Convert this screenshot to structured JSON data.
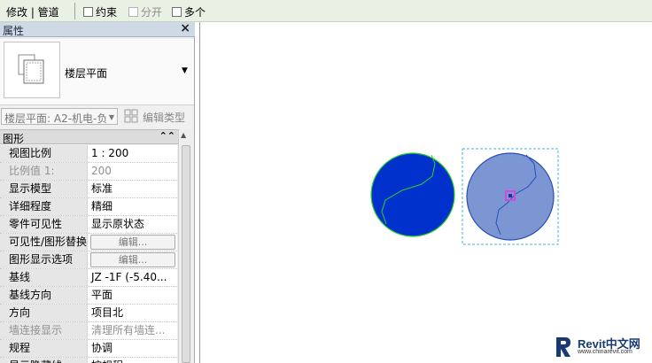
{
  "toolbar": {
    "context_title": "修改 | 管道",
    "options": [
      {
        "label": "约束",
        "checked": false,
        "enabled": true
      },
      {
        "label": "分开",
        "checked": false,
        "enabled": false
      },
      {
        "label": "多个",
        "checked": false,
        "enabled": true
      }
    ]
  },
  "properties": {
    "title": "属性",
    "close_icon": "×",
    "type_selector": {
      "type_name": "楼层平面",
      "thumbnail_icon": "floor-plan-view-icon",
      "dropdown_icon": "▼"
    },
    "instance_combo": {
      "value": "楼层平面: A2-机电-负",
      "dropdown_icon": "▼"
    },
    "edit_type_label": "编辑类型",
    "group": {
      "title": "图形",
      "collapse_icon": "⌃⌃"
    },
    "rows": [
      {
        "name": "视图比例",
        "value": "1 : 200",
        "enabled": true,
        "button": false
      },
      {
        "name": "比例值 1:",
        "value": "200",
        "enabled": false,
        "button": false
      },
      {
        "name": "显示模型",
        "value": "标准",
        "enabled": true,
        "button": false
      },
      {
        "name": "详细程度",
        "value": "精细",
        "enabled": true,
        "button": false
      },
      {
        "name": "零件可见性",
        "value": "显示原状态",
        "enabled": true,
        "button": false
      },
      {
        "name": "可见性/图形替换",
        "value": "编辑...",
        "enabled": true,
        "button": true
      },
      {
        "name": "图形显示选项",
        "value": "编辑...",
        "enabled": true,
        "button": true
      },
      {
        "name": "基线",
        "value": "JZ -1F (-5.40...",
        "enabled": true,
        "button": false
      },
      {
        "name": "基线方向",
        "value": "平面",
        "enabled": true,
        "button": false
      },
      {
        "name": "方向",
        "value": "项目北",
        "enabled": true,
        "button": false
      },
      {
        "name": "墙连接显示",
        "value": "清理所有墙连...",
        "enabled": false,
        "button": false
      },
      {
        "name": "规程",
        "value": "协调",
        "enabled": true,
        "button": false
      },
      {
        "name": "显示隐藏线",
        "value": "按规程",
        "enabled": true,
        "button": false
      }
    ]
  },
  "canvas": {
    "colors": {
      "fill_dark": "#0031cc",
      "fill_selected": "#7b96d2",
      "stroke_dark": "#2cd12c",
      "stroke_selected": "#2a4fb4",
      "selection_box": "#3fb6e0",
      "grip": "#d24bd2"
    }
  },
  "watermark": {
    "brand": "Revit中文网",
    "url": "www.chinarevit.com"
  }
}
